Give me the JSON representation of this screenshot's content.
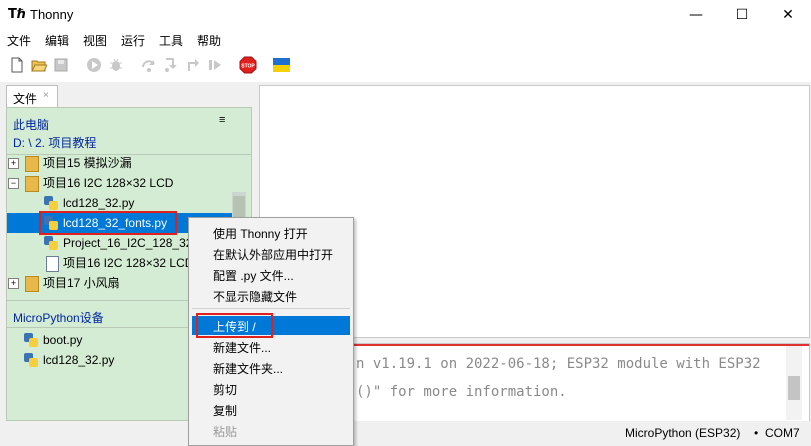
{
  "window": {
    "icon": "thonny-app-icon",
    "title": "Thonny",
    "minimize": "—",
    "maximize": "☐",
    "close": "✕"
  },
  "menu": [
    "文件",
    "编辑",
    "视图",
    "运行",
    "工具",
    "帮助"
  ],
  "toolbar": {
    "icons": [
      "new-file-icon",
      "open-file-icon",
      "save-icon",
      "run-icon",
      "debug-icon",
      "step-over-icon",
      "step-into-icon",
      "step-out-icon",
      "resume-icon",
      "stop-icon",
      "ukraine-flag-icon"
    ],
    "stop_label": "STOP"
  },
  "files": {
    "tab_label": "文件",
    "tab_close": "×",
    "panel_menu_icon": "≡",
    "this_pc": "此电脑",
    "path": "D: \\ 2. 项目教程",
    "tree": [
      {
        "expander": "+",
        "type": "folder",
        "label": "项目15 模拟沙漏"
      },
      {
        "expander": "−",
        "type": "folder",
        "label": "项目16 I2C 128×32 LCD"
      },
      {
        "type": "py",
        "label": "lcd128_32.py"
      },
      {
        "type": "py",
        "label": "lcd128_32_fonts.py",
        "selected": true
      },
      {
        "type": "py",
        "label": "Project_16_I2C_128_32"
      },
      {
        "type": "doc",
        "label": "项目16 I2C 128×32 LCD"
      },
      {
        "expander": "+",
        "type": "folder",
        "label": "项目17 小风扇"
      }
    ],
    "device_header": "MicroPython设备",
    "device_files": [
      "boot.py",
      "lcd128_32.py"
    ]
  },
  "context_menu": {
    "items_top": [
      "使用 Thonny 打开",
      "在默认外部应用中打开",
      "配置 .py 文件...",
      "不显示隐藏文件"
    ],
    "highlighted": "上传到 /",
    "items_bottom": [
      "新建文件...",
      "新建文件夹...",
      "剪切",
      "复制",
      "粘贴"
    ]
  },
  "shell": {
    "line1": "n v1.19.1 on 2022-06-18; ESP32 module with ESP32",
    "line2": "()\" for more information."
  },
  "status": {
    "interpreter": "MicroPython (ESP32)",
    "separator": "•",
    "port": "COM7"
  },
  "colors": {
    "selection": "#0078d7",
    "panel_bg": "#d4ecd3",
    "header_text": "#00269f",
    "highlight_box": "#e0201c"
  }
}
